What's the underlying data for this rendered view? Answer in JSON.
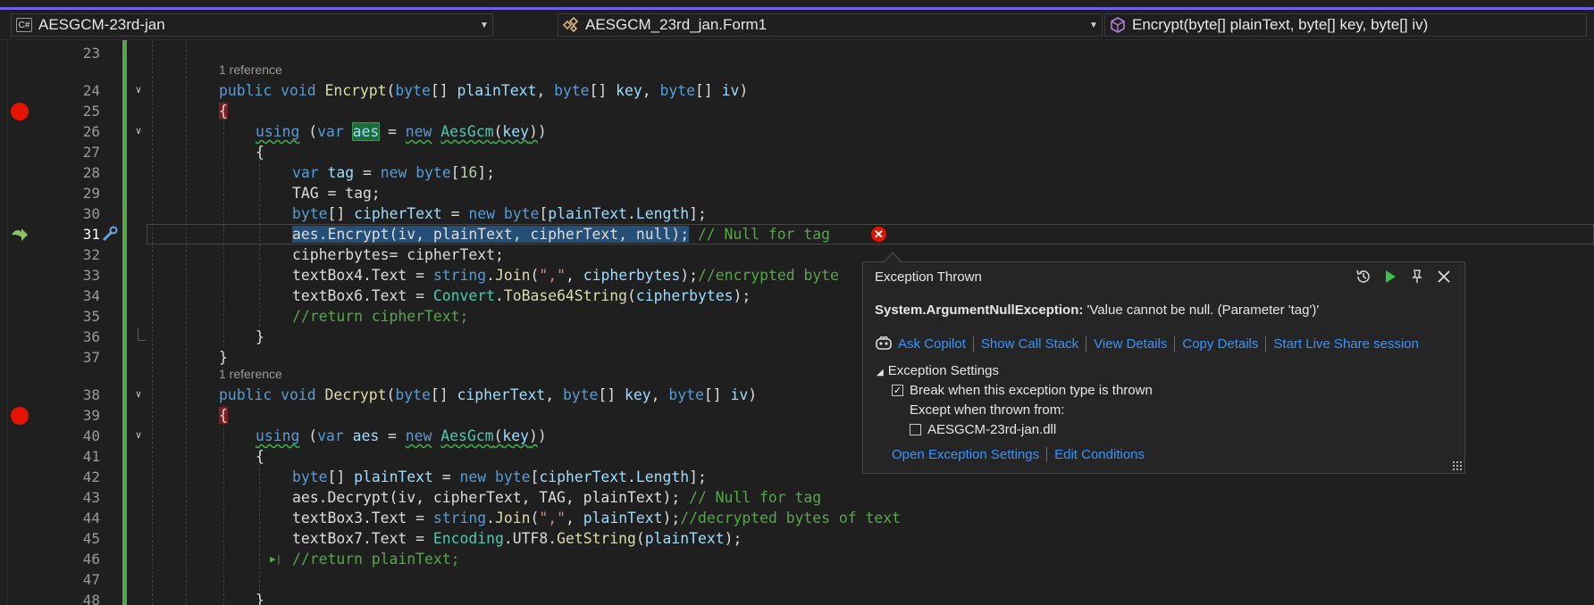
{
  "nav": {
    "project": "AESGCM-23rd-jan",
    "class": "AESGCM_23rd_jan.Form1",
    "member": "Encrypt(byte[] plainText, byte[] key, byte[] iv)",
    "project_icon": "csharp-project-icon",
    "class_icon": "class-icon",
    "member_icon": "method-icon"
  },
  "refs": {
    "encrypt": "1 reference",
    "decrypt": "1 reference"
  },
  "line_numbers": [
    "23",
    "24",
    "25",
    "26",
    "27",
    "28",
    "29",
    "30",
    "31",
    "32",
    "33",
    "34",
    "35",
    "36",
    "37",
    "38",
    "39",
    "40",
    "41",
    "42",
    "43",
    "44",
    "45",
    "46",
    "47",
    "48"
  ],
  "code": {
    "l24": {
      "kw1": "public",
      "kw2": "void",
      "fn": "Encrypt",
      "p1t": "byte",
      "p1": "plainText",
      "p2t": "byte",
      "p2": "key",
      "p3t": "byte",
      "p3": "iv"
    },
    "l26": {
      "kw": "using",
      "var": "var",
      "name": "aes",
      "new": "new",
      "type": "AesGcm",
      "arg": "key"
    },
    "l28": {
      "var": "var",
      "name": "tag",
      "new": "new",
      "type": "byte",
      "num": "16"
    },
    "l29": {
      "text": "TAG = tag;"
    },
    "l30": {
      "type": "byte",
      "name": "cipherText",
      "new": "new",
      "type2": "byte",
      "arg": "plainText",
      "prop": "Length"
    },
    "l31": {
      "code": "aes.Encrypt(iv, plainText, cipherText, null);",
      "comment": "// Null for tag"
    },
    "l32": {
      "text": "cipherbytes= cipherText;"
    },
    "l33": {
      "lhs": "textBox4.Text =",
      "type": "string",
      "fn": "Join",
      "str": "\",\"",
      "arg": "cipherbytes",
      "comment": "//encrypted byte"
    },
    "l34": {
      "lhs": "textBox6.Text =",
      "type": "Convert",
      "fn": "ToBase64String",
      "arg": "cipherbytes"
    },
    "l35": {
      "comment": "//return cipherText;"
    },
    "l38": {
      "kw1": "public",
      "kw2": "void",
      "fn": "Decrypt",
      "p1t": "byte",
      "p1": "cipherText",
      "p2t": "byte",
      "p2": "key",
      "p3t": "byte",
      "p3": "iv"
    },
    "l40": {
      "kw": "using",
      "var": "var",
      "name": "aes",
      "new": "new",
      "type": "AesGcm",
      "arg": "key"
    },
    "l42": {
      "type": "byte",
      "name": "plainText",
      "new": "new",
      "type2": "byte",
      "arg": "cipherText",
      "prop": "Length"
    },
    "l43": {
      "code": "aes.Decrypt(iv, cipherText, TAG, plainText);",
      "comment": "// Null for tag"
    },
    "l44": {
      "lhs": "textBox3.Text =",
      "type": "string",
      "fn": "Join",
      "str": "\",\"",
      "arg": "plainText",
      "comment": "//decrypted bytes of text"
    },
    "l45": {
      "lhs": "textBox7.Text =",
      "type": "Encoding",
      "mid": "UTF8",
      "fn": "GetString",
      "arg": "plainText"
    },
    "l46": {
      "comment": "//return plainText;"
    }
  },
  "exception": {
    "title": "Exception Thrown",
    "type": "System.ArgumentNullException:",
    "message": "'Value cannot be null. (Parameter 'tag')'",
    "links": [
      "Ask Copilot",
      "Show Call Stack",
      "View Details",
      "Copy Details",
      "Start Live Share session"
    ],
    "settings_header": "Exception Settings",
    "break_label": "Break when this exception type is thrown",
    "break_checked": true,
    "except_label": "Except when thrown from:",
    "dll_label": "AESGCM-23rd-jan.dll",
    "dll_checked": false,
    "bottom_links": [
      "Open Exception Settings",
      "Edit Conditions"
    ]
  },
  "colors": {
    "accent": "#7160e8",
    "breakpoint": "#e51400",
    "link": "#3794ff",
    "comment": "#57a64a"
  }
}
